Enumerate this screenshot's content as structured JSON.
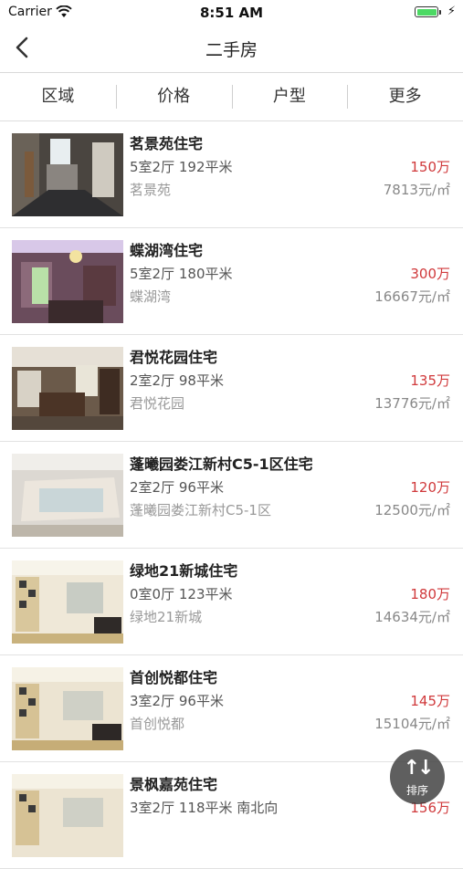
{
  "status_bar": {
    "carrier": "Carrier",
    "time": "8:51 AM"
  },
  "nav": {
    "title": "二手房"
  },
  "filters": [
    "区域",
    "价格",
    "户型",
    "更多"
  ],
  "listings": [
    {
      "name": "茗景苑住宅",
      "spec": "5室2厅  192平米",
      "community": "茗景苑",
      "price": "150万",
      "unit_price": "7813元/㎡"
    },
    {
      "name": "蝶湖湾住宅",
      "spec": "5室2厅  180平米",
      "community": "蝶湖湾",
      "price": "300万",
      "unit_price": "16667元/㎡"
    },
    {
      "name": "君悦花园住宅",
      "spec": "2室2厅  98平米",
      "community": "君悦花园",
      "price": "135万",
      "unit_price": "13776元/㎡"
    },
    {
      "name": "蓬曦园娄江新村C5-1区住宅",
      "spec": "2室2厅  96平米",
      "community": "蓬曦园娄江新村C5-1区",
      "price": "120万",
      "unit_price": "12500元/㎡"
    },
    {
      "name": "绿地21新城住宅",
      "spec": "0室0厅  123平米",
      "community": "绿地21新城",
      "price": "180万",
      "unit_price": "14634元/㎡"
    },
    {
      "name": "首创悦都住宅",
      "spec": "3室2厅  96平米",
      "community": "首创悦都",
      "price": "145万",
      "unit_price": "15104元/㎡"
    },
    {
      "name": "景枫嘉苑住宅",
      "spec": "3室2厅  118平米  南北向",
      "community": "",
      "price": "156万",
      "unit_price": ""
    }
  ],
  "sort_button": {
    "label": "排序",
    "icon": "sort-arrows-icon"
  },
  "colors": {
    "price": "#d0393b",
    "battery": "#4cd964"
  }
}
